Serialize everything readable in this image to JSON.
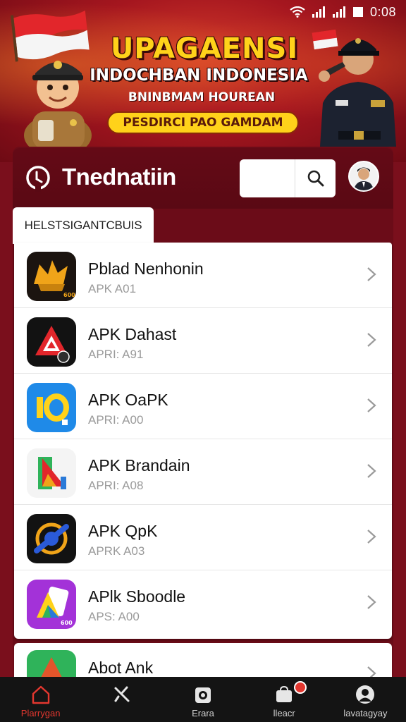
{
  "status_bar": {
    "time": "0:08"
  },
  "banner": {
    "title": "UPAGAENSI",
    "subtitle": "INDOCHBAN INDONESIA",
    "tagline": "BNINBMAM HOUREAN",
    "pill": "PESDIRCI PAO GAMDAM"
  },
  "header": {
    "app_title": "Tnednatiin",
    "search_placeholder": ""
  },
  "tab": {
    "label": "HELSTSIGANTCBUIS"
  },
  "apps": [
    {
      "name": "Pblad Nenhonin",
      "version": "APK A01",
      "icon": "crown-icon"
    },
    {
      "name": "APK Dahast",
      "version": "APRI: A91",
      "icon": "triangle-logo-icon"
    },
    {
      "name": "APK OaPK",
      "version": "APRI: A00",
      "icon": "io-logo-icon"
    },
    {
      "name": "APK Brandain",
      "version": "APRI: A08",
      "icon": "play-logo-icon"
    },
    {
      "name": "APK QpK",
      "version": "APRK A03",
      "icon": "ring-logo-icon"
    },
    {
      "name": "APlk Sboodle",
      "version": "APS: A00",
      "icon": "cards-logo-icon"
    }
  ],
  "partial_app": {
    "name": "Abot Ank",
    "icon": "triangle-green-icon"
  },
  "bottom_nav": [
    {
      "label": "Plarrygan",
      "icon": "home-icon",
      "active": true
    },
    {
      "label": "",
      "icon": "tools-icon",
      "active": false
    },
    {
      "label": "Erara",
      "icon": "camera-icon",
      "active": false
    },
    {
      "label": "lleacr",
      "icon": "bag-icon",
      "active": false
    },
    {
      "label": "lavatagyay",
      "icon": "profile-icon",
      "active": false
    }
  ],
  "colors": {
    "accent": "#e3372f",
    "banner_red": "#a5161f",
    "panel": "#6b0c18",
    "gold": "#ffd21a"
  }
}
